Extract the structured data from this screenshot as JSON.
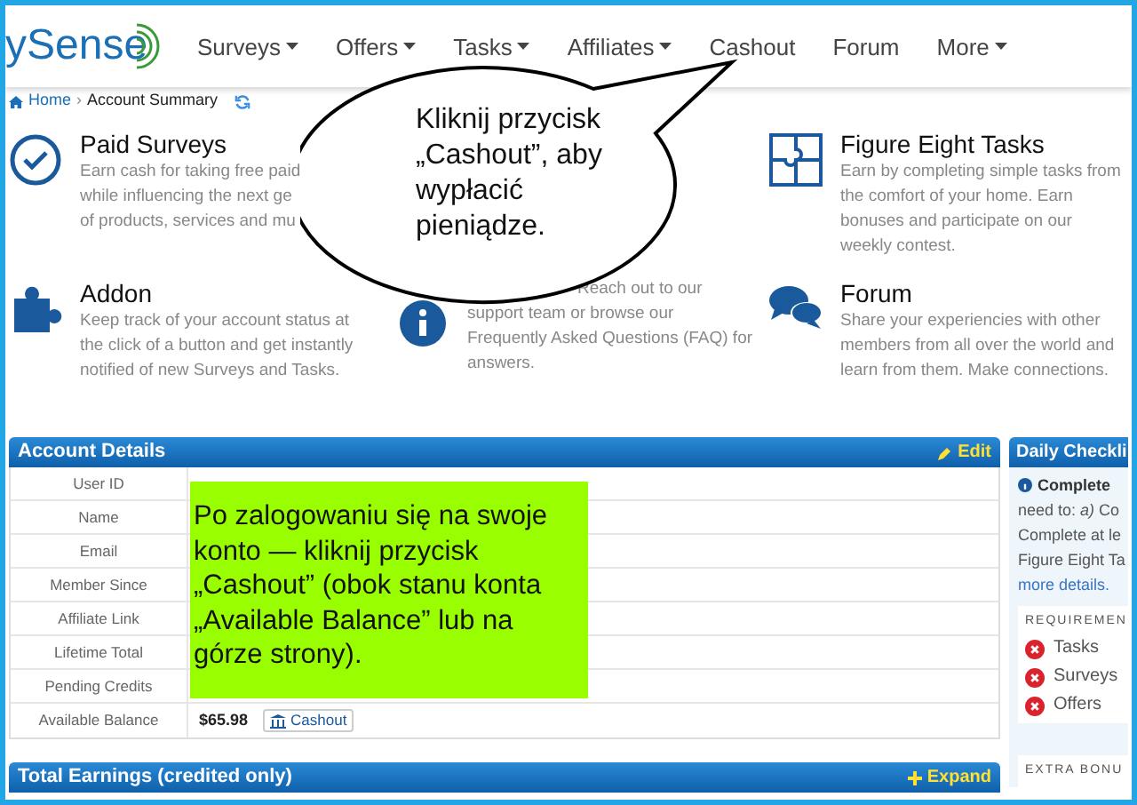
{
  "header": {
    "logo": "ySense",
    "nav": [
      {
        "label": "Surveys",
        "dropdown": true
      },
      {
        "label": "Offers",
        "dropdown": true
      },
      {
        "label": "Tasks",
        "dropdown": true
      },
      {
        "label": "Affiliates",
        "dropdown": true
      },
      {
        "label": "Cashout",
        "dropdown": false
      },
      {
        "label": "Forum",
        "dropdown": false
      },
      {
        "label": "More",
        "dropdown": true
      }
    ]
  },
  "breadcrumb": {
    "home": "Home",
    "separator": "›",
    "current": "Account Summary"
  },
  "features": {
    "top_left": {
      "kind": "surveys",
      "title": "Paid Surveys",
      "lines": [
        "Earn cash for taking free paid",
        "while influencing the next ge",
        "of products, services and mu"
      ]
    },
    "top_right": {
      "kind": "tasks",
      "title": "Figure Eight Tasks",
      "lines": [
        "Earn by completing simple tasks from",
        "the comfort of your home. Earn",
        "bonuses and participate on our",
        "weekly contest."
      ]
    },
    "bottom_left": {
      "kind": "addon",
      "title": "Addon",
      "lines": [
        "Keep track of your account status at",
        "the click of a button and get instantly",
        "notified of new Surveys and Tasks."
      ]
    },
    "bottom_middle": {
      "kind": "support",
      "lines": [
        "Reach out to our",
        "support team or browse our",
        "Frequently Asked Questions (FAQ) for",
        "answers."
      ]
    },
    "bottom_right": {
      "kind": "forum",
      "title": "Forum",
      "lines": [
        "Share your experiencies with other",
        "members from all over the world and",
        "learn from them. Make connections."
      ]
    }
  },
  "account_details": {
    "title": "Account Details",
    "edit": "Edit",
    "rows": [
      {
        "label": "User ID"
      },
      {
        "label": "Name"
      },
      {
        "label": "Email"
      },
      {
        "label": "Member Since"
      },
      {
        "label": "Affiliate Link"
      },
      {
        "label": "Lifetime Total"
      },
      {
        "label": "Pending Credits"
      },
      {
        "label": "Available Balance",
        "value": "$65.98",
        "action": "Cashout"
      }
    ]
  },
  "total_earnings": {
    "title": "Total Earnings (credited only)",
    "expand": "Expand"
  },
  "daily_checklist": {
    "title": "Daily Checkli",
    "intro": [
      "Complete",
      "need to: *a)* Co",
      "Complete at le",
      "Figure Eight Ta"
    ],
    "link": "more details.",
    "requirements_heading": "REQUIREMEN",
    "requirements": [
      {
        "label": "Tasks",
        "done": false
      },
      {
        "label": "Surveys",
        "done": false
      },
      {
        "label": "Offers",
        "done": false
      }
    ],
    "bonus_heading": "EXTRA BONU"
  },
  "speech_bubble": "Kliknij przycisk „Cashout”, aby wypłacić pieniądze.",
  "note": "Po zalogowaniu się na swoje konto — kliknij przycisk „Cashout” (obok stanu konta „Available Balance” lub na górze strony)."
}
